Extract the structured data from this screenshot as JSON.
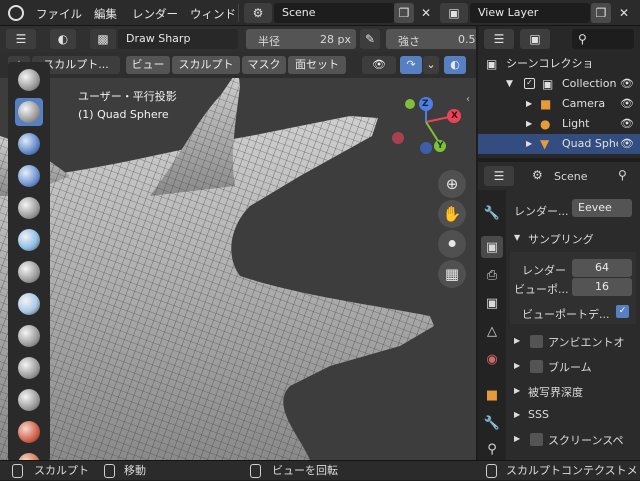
{
  "menu": {
    "file": "ファイル",
    "edit": "編集",
    "render": "レンダー",
    "window": "ウィンド"
  },
  "scene_selector": {
    "value": "Scene"
  },
  "view_layer_selector": {
    "value": "View Layer"
  },
  "tool_settings": {
    "brush_name": "Draw Sharp",
    "radius_label": "半径",
    "radius_value": "28 px",
    "strength_label": "強さ",
    "strength_value": "0.5"
  },
  "viewport_header": {
    "mode": "スカルプト...",
    "view": "ビュー",
    "sculpt": "スカルプト",
    "mask": "マスク",
    "face_sets": "面セット"
  },
  "viewport_overlay": {
    "view_name": "ユーザー・平行投影",
    "object_name": "(1) Quad Sphere"
  },
  "gizmo": {
    "x": "X",
    "y": "Y",
    "z": "Z"
  },
  "outliner": {
    "title": "シーンコレクショ",
    "items": [
      {
        "label": "Collection"
      },
      {
        "label": "Camera"
      },
      {
        "label": "Light"
      },
      {
        "label": "Quad Sphe"
      }
    ]
  },
  "properties": {
    "scene_label": "Scene",
    "render_engine_label": "レンダー...",
    "render_engine_value": "Eevee",
    "sampling_header": "サンプリング",
    "render_samples_label": "レンダー",
    "render_samples_value": "64",
    "viewport_samples_label": "ビューポ...",
    "viewport_samples_value": "16",
    "viewport_denoise_label": "ビューポートデ...",
    "panels": [
      "アンビエントオ",
      "ブルーム",
      "被写界深度",
      "SSS",
      "スクリーンスペ"
    ]
  },
  "statusbar": {
    "left": "スカルプト",
    "move": "移動",
    "rotate": "ビューを回転",
    "context": "スカルプトコンテクストメ"
  },
  "colors": {
    "accent": "#5680c2",
    "viewport_bg": "#3d3d3d",
    "x_axis": "#e94457",
    "y_axis": "#7ec03a",
    "z_axis": "#4d7fde"
  }
}
